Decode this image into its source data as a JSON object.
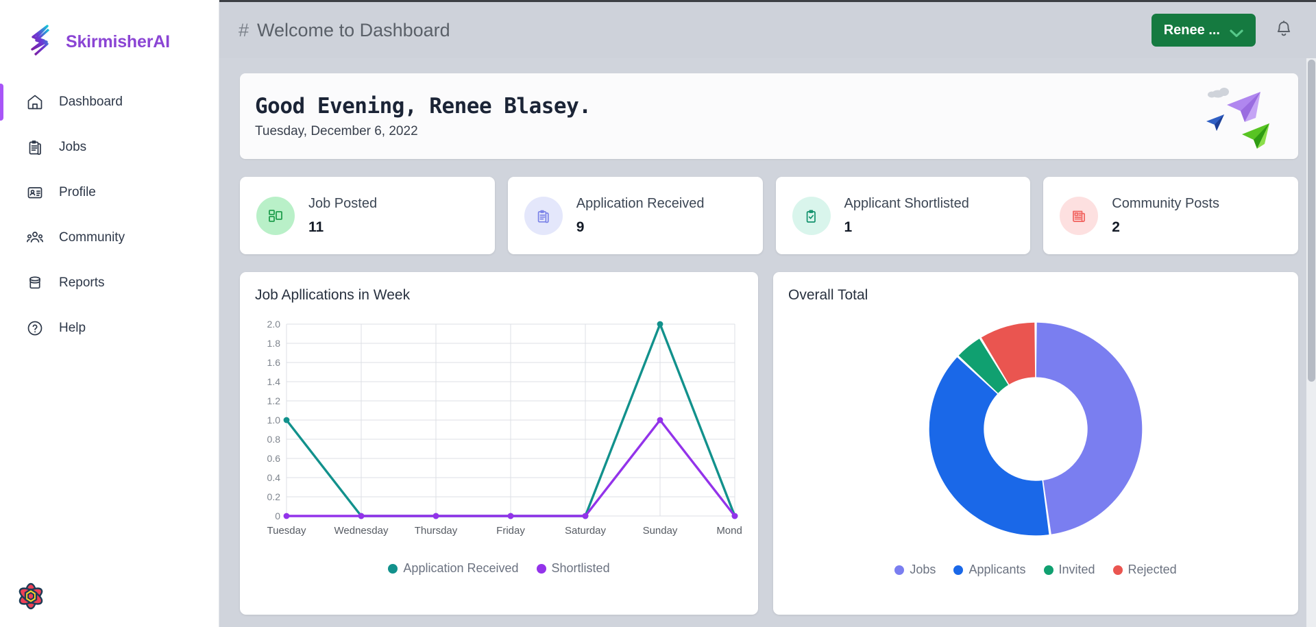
{
  "brand": {
    "name": "SkirmisherAI",
    "logo_icon": "skirmisher-logo-icon",
    "accent": "#8b45d4"
  },
  "sidebar": {
    "items": [
      {
        "label": "Dashboard",
        "icon": "home-icon",
        "active": true
      },
      {
        "label": "Jobs",
        "icon": "clipboard-icon",
        "active": false
      },
      {
        "label": "Profile",
        "icon": "id-card-icon",
        "active": false
      },
      {
        "label": "Community",
        "icon": "people-group-icon",
        "active": false
      },
      {
        "label": "Reports",
        "icon": "archive-box-icon",
        "active": false
      },
      {
        "label": "Help",
        "icon": "question-circle-icon",
        "active": false
      }
    ],
    "floating_logo_icon": "atom-flower-icon"
  },
  "topbar": {
    "hash": "#",
    "title": "Welcome to Dashboard",
    "user_button_label": "Renee ...",
    "user_button_color": "#157a40",
    "chevron_icon": "chevron-down-icon",
    "bell_icon": "bell-icon"
  },
  "banner": {
    "greeting": "Good Evening, Renee Blasey.",
    "date": "Tuesday, December 6, 2022",
    "illustration_icon": "paper-planes-icon"
  },
  "stats": [
    {
      "label": "Job Posted",
      "value": "11",
      "icon": "job-posted-icon",
      "bg": "#b9f0c8",
      "fg": "#1f9d4d"
    },
    {
      "label": "Application Received",
      "value": "9",
      "icon": "application-received-icon",
      "bg": "#e4e7fb",
      "fg": "#7b83e8"
    },
    {
      "label": "Applicant Shortlisted",
      "value": "1",
      "icon": "applicant-shortlisted-icon",
      "bg": "#d9f5ec",
      "fg": "#12916c"
    },
    {
      "label": "Community Posts",
      "value": "2",
      "icon": "community-posts-icon",
      "bg": "#fde0e0",
      "fg": "#f1625e"
    }
  ],
  "panels": {
    "line_panel_title": "Job Apllications in Week",
    "donut_panel_title": "Overall Total"
  },
  "chart_data": [
    {
      "type": "line",
      "title": "Job Apllications in Week",
      "xlabel": "",
      "ylabel": "",
      "ylim": [
        0,
        2.0
      ],
      "grid": true,
      "legend_position": "bottom",
      "categories": [
        "Tuesday",
        "Wednesday",
        "Thursday",
        "Friday",
        "Saturday",
        "Sunday",
        "Monday"
      ],
      "yticks": [
        "0",
        "0.2",
        "0.4",
        "0.6",
        "0.8",
        "1.0",
        "1.2",
        "1.4",
        "1.6",
        "1.8",
        "2.0"
      ],
      "series": [
        {
          "name": "Application Received",
          "color": "#12918c",
          "values": [
            1,
            0,
            0,
            0,
            0,
            2,
            0
          ]
        },
        {
          "name": "Shortlisted",
          "color": "#9333ea",
          "values": [
            0,
            0,
            0,
            0,
            0,
            1,
            0
          ]
        }
      ]
    },
    {
      "type": "pie",
      "title": "Overall Total",
      "legend_position": "bottom",
      "donut": true,
      "labels": [
        "Jobs",
        "Applicants",
        "Invited",
        "Rejected"
      ],
      "values": [
        11,
        9,
        1,
        2
      ],
      "colors": [
        "#7a7ef0",
        "#1a68e8",
        "#10a070",
        "#ea5550"
      ]
    }
  ]
}
